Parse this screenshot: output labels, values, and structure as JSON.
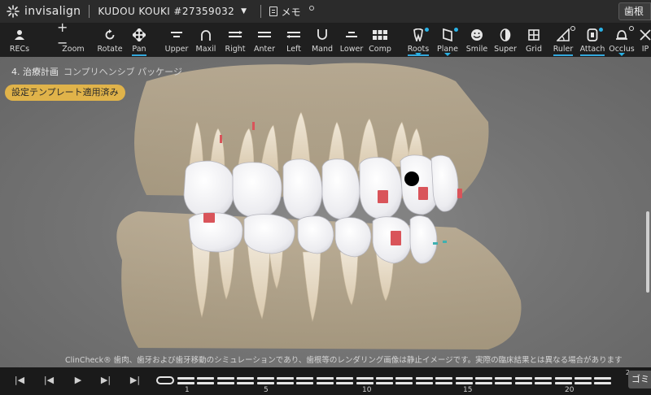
{
  "header": {
    "brand": "invisalign",
    "patient": "KUDOU KOUKI #27359032",
    "memo": "メモ",
    "right_button": "歯根"
  },
  "toolbar": {
    "items": [
      {
        "label": "RECs",
        "icon": "person-icon"
      },
      {
        "label": "Zoom",
        "icon": "zoom-icon"
      },
      {
        "label": "Rotate",
        "icon": "rotate-icon"
      },
      {
        "label": "Pan",
        "icon": "pan-icon",
        "active": true
      },
      {
        "label": "Upper",
        "icon": "upper-icon"
      },
      {
        "label": "Maxil",
        "icon": "maxil-icon"
      },
      {
        "label": "Right",
        "icon": "right-icon"
      },
      {
        "label": "Anter",
        "icon": "anter-icon"
      },
      {
        "label": "Left",
        "icon": "left-icon"
      },
      {
        "label": "Mand",
        "icon": "mand-icon"
      },
      {
        "label": "Lower",
        "icon": "lower-icon"
      },
      {
        "label": "Comp",
        "icon": "comp-icon"
      },
      {
        "label": "Roots",
        "icon": "roots-icon",
        "active": true
      },
      {
        "label": "Plane",
        "icon": "plane-icon"
      },
      {
        "label": "Smile",
        "icon": "smile-icon"
      },
      {
        "label": "Super",
        "icon": "super-icon"
      },
      {
        "label": "Grid",
        "icon": "grid-icon"
      },
      {
        "label": "Ruler",
        "icon": "ruler-icon",
        "active": true
      },
      {
        "label": "Attach",
        "icon": "attach-icon",
        "active": true
      },
      {
        "label": "Occlus",
        "icon": "occlus-icon"
      },
      {
        "label": "IP",
        "icon": "ip-icon"
      }
    ]
  },
  "viewport": {
    "stage_label": "4. 治療計画",
    "package": "コンプリヘンシブ パッケージ",
    "badge": "設定テンプレート適用済み",
    "disclaimer": "ClinCheck® 歯肉、歯牙および歯牙移動のシミュレーションであり、歯根等のレンダリング画像は静止イメージです。実際の臨床結果とは異なる場合があります"
  },
  "timeline": {
    "ticks": [
      "1",
      "5",
      "10",
      "15",
      "20"
    ],
    "corner": "2",
    "trash": "ゴミ"
  },
  "colors": {
    "accent": "#34a8dd",
    "badge": "#e0b34a",
    "attachment": "#d9545a"
  }
}
